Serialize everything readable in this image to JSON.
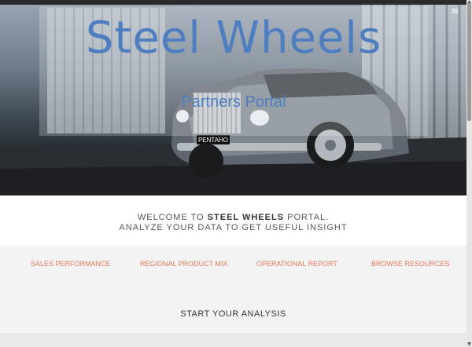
{
  "hero": {
    "title": "Steel Wheels",
    "subtitle": "Partners Portal",
    "badge_text": "PENTAHO",
    "menu_icon": "hamburger-menu-icon"
  },
  "welcome": {
    "line1_prefix": "WELCOME TO ",
    "line1_bold": "STEEL WHEELS",
    "line1_suffix": " PORTAL.",
    "line2": "ANALYZE YOUR DATA TO GET USEFUL INSIGHT"
  },
  "nav": {
    "items": [
      {
        "label": "SALES PERFORMANCE"
      },
      {
        "label": "REGIONAL PRODUCT MIX"
      },
      {
        "label": "OPERATIONAL REPORT"
      },
      {
        "label": "BROWSE RESOURCES"
      }
    ]
  },
  "analysis": {
    "heading": "START YOUR ANALYSIS"
  },
  "colors": {
    "title_blue": "#4e7ec0",
    "link_orange": "#e2795b"
  }
}
